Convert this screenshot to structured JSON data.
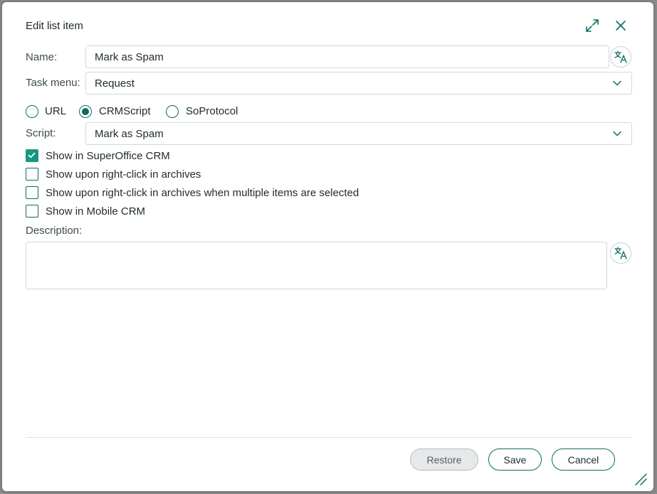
{
  "dialog": {
    "title": "Edit list item",
    "expand_icon": "expand-icon",
    "close_icon": "close-icon"
  },
  "form": {
    "name_label": "Name:",
    "name_value": "Mark as Spam",
    "task_menu_label": "Task menu:",
    "task_menu_value": "Request",
    "type_options": [
      {
        "label": "URL",
        "selected": false
      },
      {
        "label": "CRMScript",
        "selected": true
      },
      {
        "label": "SoProtocol",
        "selected": false
      }
    ],
    "script_label": "Script:",
    "script_value": "Mark as Spam",
    "checkboxes": [
      {
        "label": "Show in SuperOffice CRM",
        "checked": true
      },
      {
        "label": "Show upon right-click in archives",
        "checked": false
      },
      {
        "label": "Show upon right-click in archives when multiple items are selected",
        "checked": false
      },
      {
        "label": "Show in Mobile CRM",
        "checked": false
      }
    ],
    "description_label": "Description:",
    "description_value": ""
  },
  "buttons": {
    "restore": "Restore",
    "save": "Save",
    "cancel": "Cancel"
  },
  "colors": {
    "accent": "#0d6b63",
    "checked_fill": "#1a9582"
  }
}
